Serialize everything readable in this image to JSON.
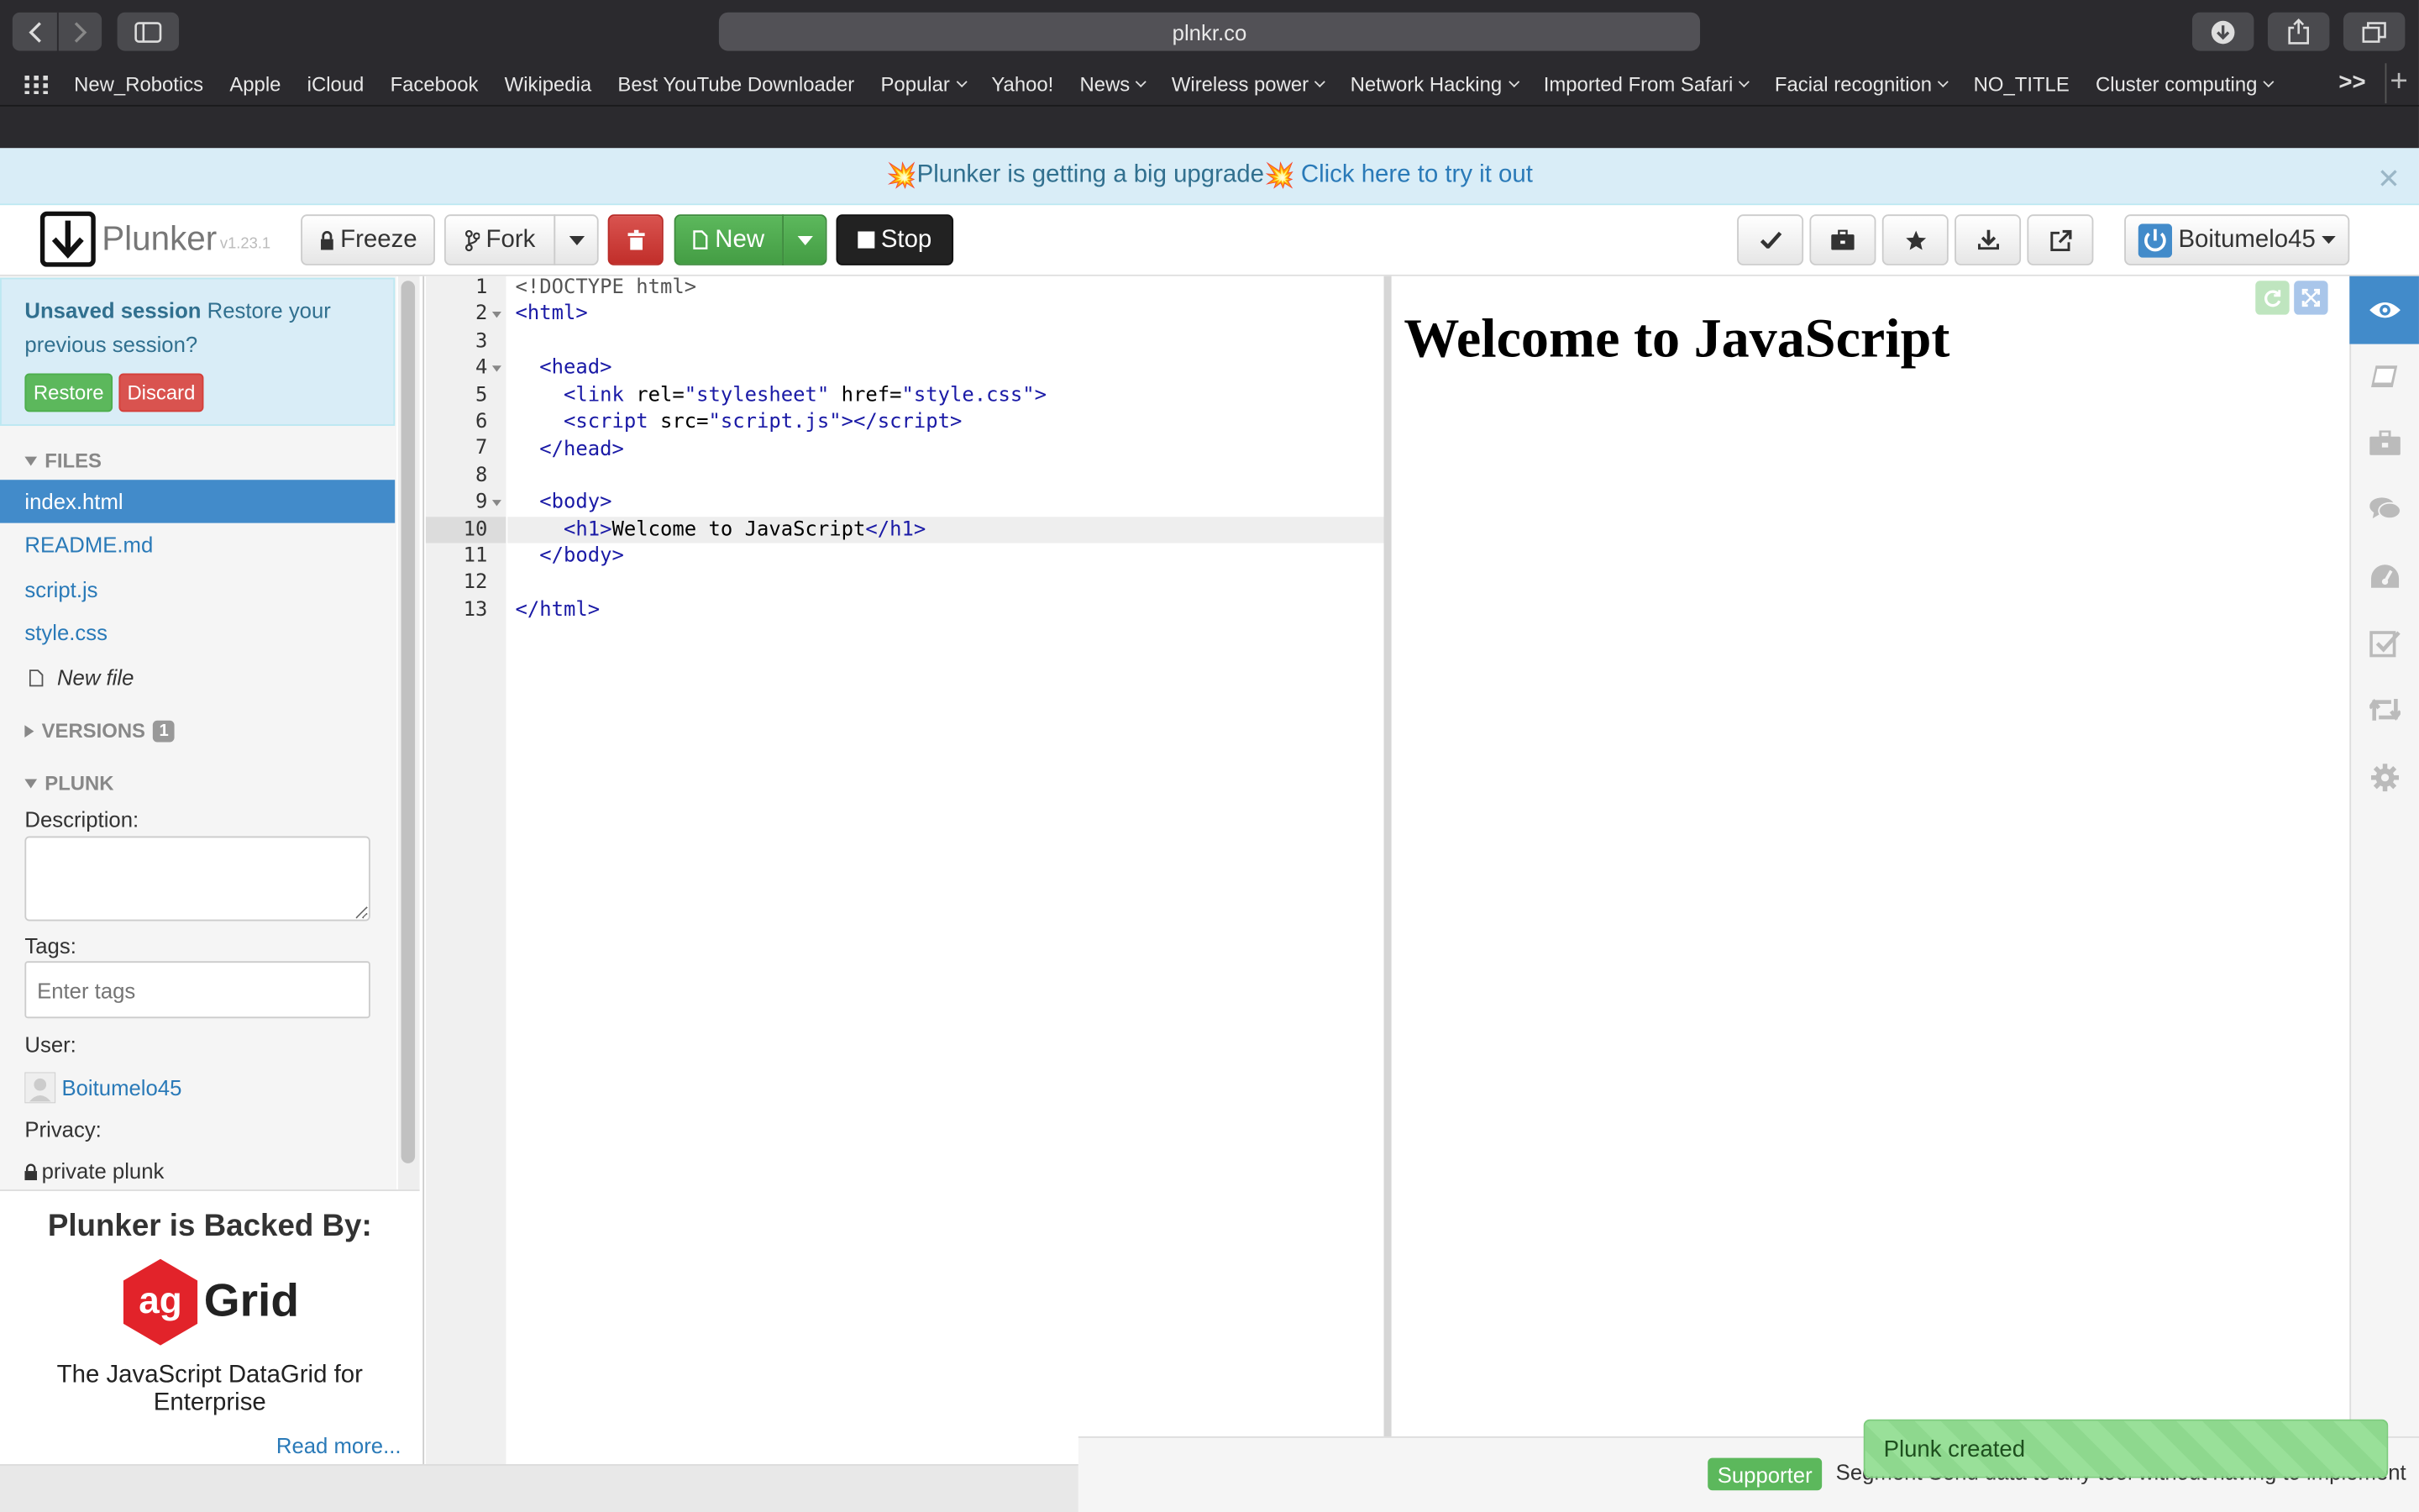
{
  "browser": {
    "url": "plnkr.co",
    "bookmarks": [
      {
        "label": "New_Robotics",
        "menu": false
      },
      {
        "label": "Apple",
        "menu": false
      },
      {
        "label": "iCloud",
        "menu": false
      },
      {
        "label": "Facebook",
        "menu": false
      },
      {
        "label": "Wikipedia",
        "menu": false
      },
      {
        "label": "Best YouTube Downloader",
        "menu": false
      },
      {
        "label": "Popular",
        "menu": true
      },
      {
        "label": "Yahoo!",
        "menu": false
      },
      {
        "label": "News",
        "menu": true
      },
      {
        "label": "Wireless power",
        "menu": true
      },
      {
        "label": "Network Hacking",
        "menu": true
      },
      {
        "label": "Imported From Safari",
        "menu": true
      },
      {
        "label": "Facial recognition",
        "menu": true
      },
      {
        "label": "NO_TITLE",
        "menu": false
      },
      {
        "label": "Cluster computing",
        "menu": true
      }
    ],
    "overflow": ">>"
  },
  "banner": {
    "emoji": "💥",
    "text": "Plunker is getting a big upgrade",
    "link": "Click here to try it out"
  },
  "toolbar": {
    "logo": "Plunker",
    "version": "v1.23.1",
    "freeze": "Freeze",
    "fork": "Fork",
    "new": "New",
    "stop": "Stop",
    "user": "Boitumelo45"
  },
  "sidebar": {
    "unsaved_title": "Unsaved session",
    "unsaved_text": "Restore your previous session?",
    "restore": "Restore",
    "discard": "Discard",
    "files_header": "FILES",
    "files": [
      "index.html",
      "README.md",
      "script.js",
      "style.css"
    ],
    "new_file": "New file",
    "versions_header": "VERSIONS",
    "versions_count": "1",
    "plunk_header": "PLUNK",
    "description_label": "Description:",
    "tags_label": "Tags:",
    "tags_placeholder": "Enter tags",
    "user_label": "User:",
    "user": "Boitumelo45",
    "privacy_label": "Privacy:",
    "privacy": "private plunk"
  },
  "ad": {
    "title": "Plunker is Backed By:",
    "brand": "Grid",
    "brand_mark": "ag",
    "tagline": "The JavaScript DataGrid for Enterprise",
    "more": "Read more..."
  },
  "editor": {
    "line_numbers": [
      "1",
      "2",
      "3",
      "4",
      "5",
      "6",
      "7",
      "8",
      "9",
      "10",
      "11",
      "12",
      "13"
    ]
  },
  "preview": {
    "heading": "Welcome to JavaScript"
  },
  "footer": {
    "supporter": "Supporter",
    "segment": "Segment Send data to any tool without having to implement",
    "toast": "Plunk created"
  }
}
